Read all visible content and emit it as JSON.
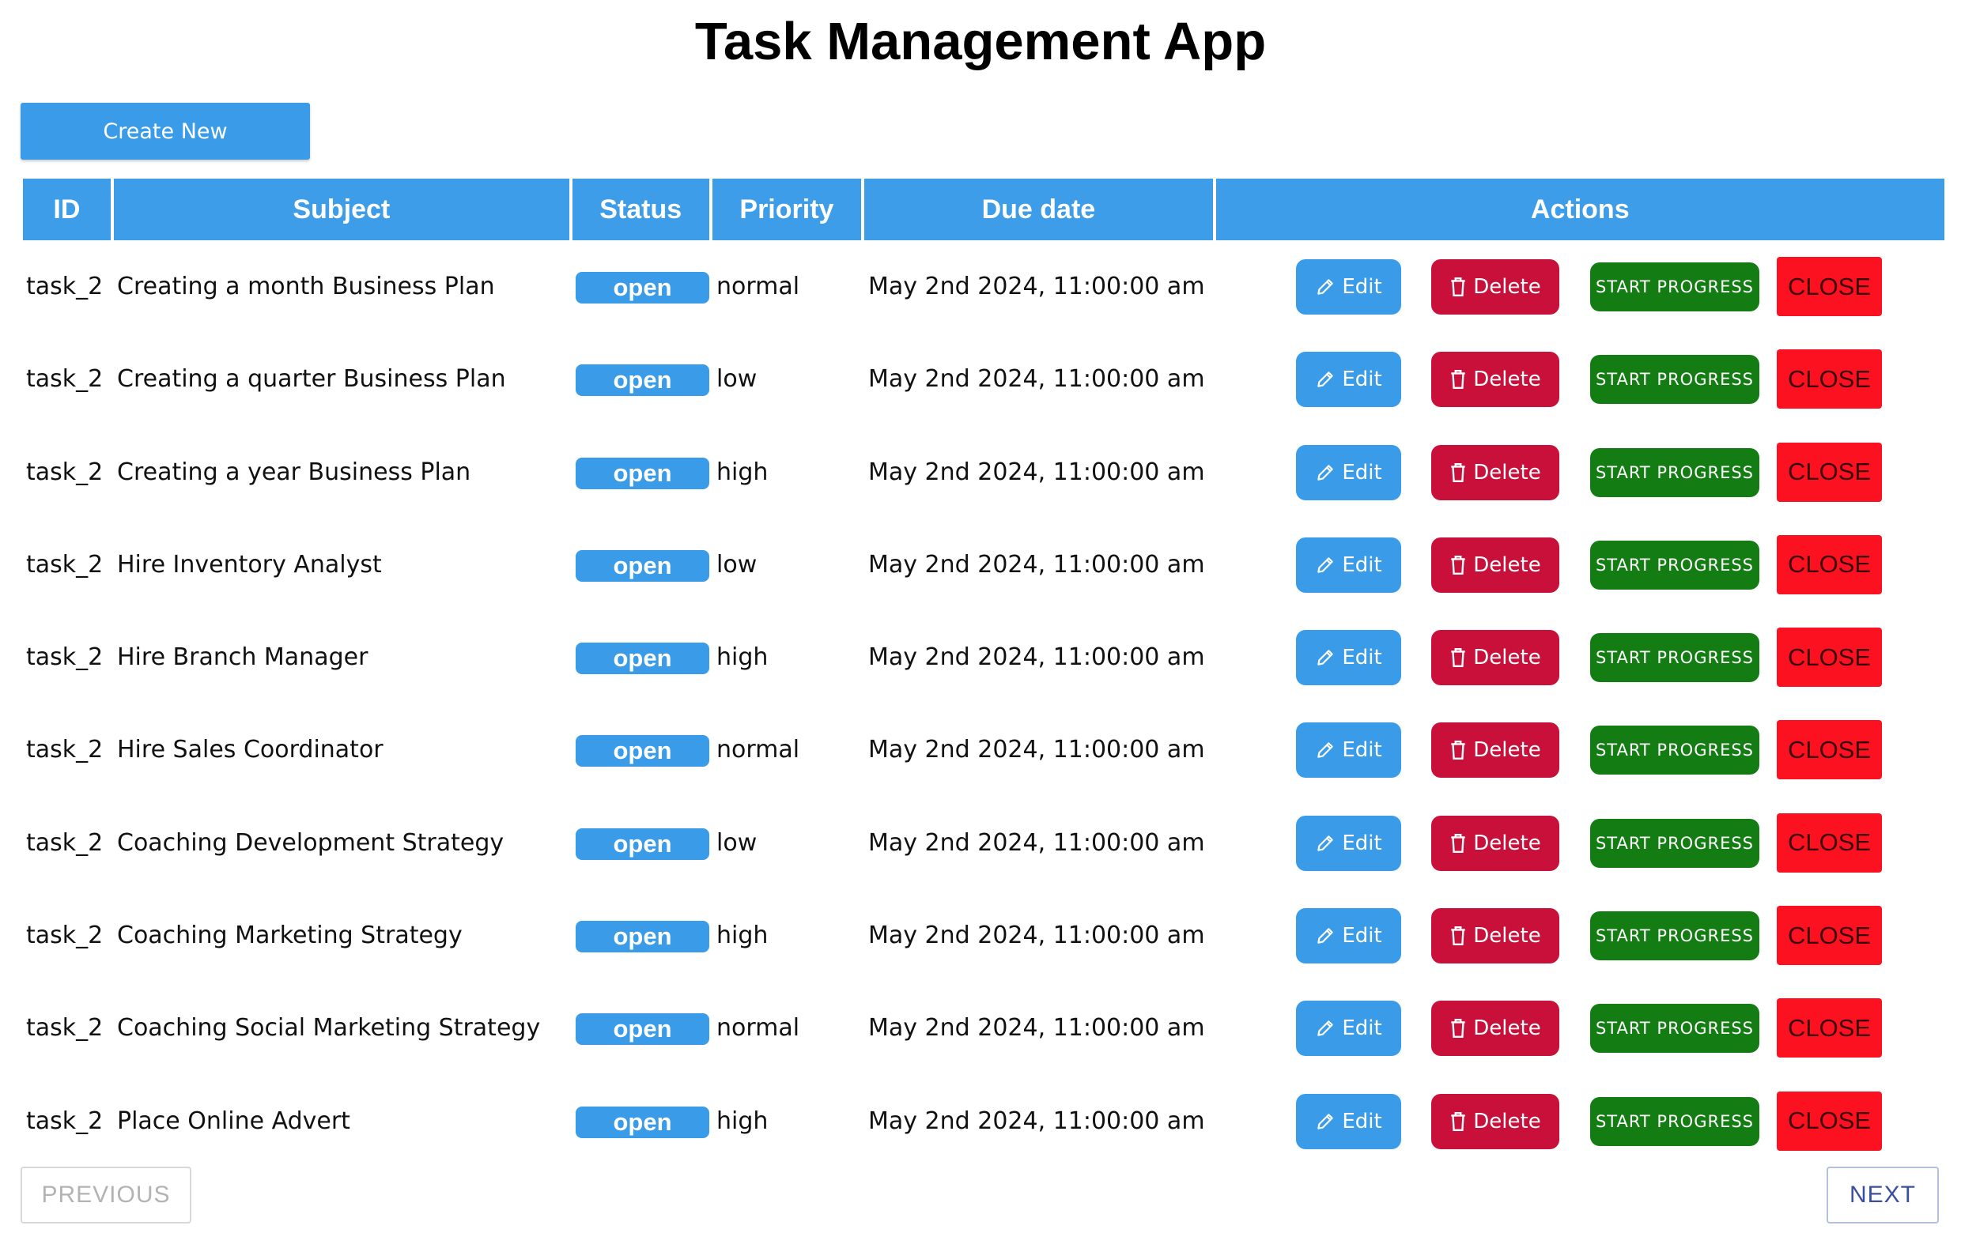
{
  "app": {
    "title": "Task Management App"
  },
  "toolbar": {
    "create_label": "Create New"
  },
  "table": {
    "columns": [
      "ID",
      "Subject",
      "Status",
      "Priority",
      "Due date",
      "Actions"
    ],
    "rows": [
      {
        "id": "task_2",
        "subject": "Creating a month Business Plan",
        "status": "open",
        "priority": "normal",
        "due": "May 2nd 2024, 11:00:00 am"
      },
      {
        "id": "task_2",
        "subject": "Creating a quarter Business Plan",
        "status": "open",
        "priority": "low",
        "due": "May 2nd 2024, 11:00:00 am"
      },
      {
        "id": "task_2",
        "subject": "Creating a year Business Plan",
        "status": "open",
        "priority": "high",
        "due": "May 2nd 2024, 11:00:00 am"
      },
      {
        "id": "task_2",
        "subject": "Hire Inventory Analyst",
        "status": "open",
        "priority": "low",
        "due": "May 2nd 2024, 11:00:00 am"
      },
      {
        "id": "task_2",
        "subject": "Hire Branch Manager",
        "status": "open",
        "priority": "high",
        "due": "May 2nd 2024, 11:00:00 am"
      },
      {
        "id": "task_2",
        "subject": "Hire Sales Coordinator",
        "status": "open",
        "priority": "normal",
        "due": "May 2nd 2024, 11:00:00 am"
      },
      {
        "id": "task_2",
        "subject": "Coaching Development Strategy",
        "status": "open",
        "priority": "low",
        "due": "May 2nd 2024, 11:00:00 am"
      },
      {
        "id": "task_2",
        "subject": "Coaching Marketing Strategy",
        "status": "open",
        "priority": "high",
        "due": "May 2nd 2024, 11:00:00 am"
      },
      {
        "id": "task_2",
        "subject": "Coaching Social Marketing Strategy",
        "status": "open",
        "priority": "normal",
        "due": "May 2nd 2024, 11:00:00 am"
      },
      {
        "id": "task_2",
        "subject": "Place Online Advert",
        "status": "open",
        "priority": "high",
        "due": "May 2nd 2024, 11:00:00 am"
      }
    ]
  },
  "actions": {
    "edit_label": "Edit",
    "edit_icon": "pencil-icon",
    "delete_label": "Delete",
    "delete_icon": "trash-icon",
    "start_label": "START PROGRESS",
    "close_label": "CLOSE"
  },
  "pagination": {
    "previous_label": "PREVIOUS",
    "next_label": "NEXT"
  },
  "colors": {
    "primary": "#3a9ce8",
    "danger": "#c8103a",
    "success": "#137d13",
    "close": "#fb1120"
  }
}
